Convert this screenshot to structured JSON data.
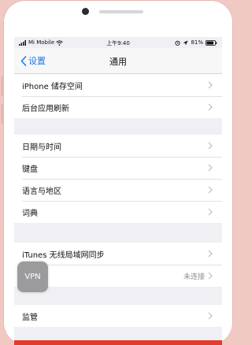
{
  "status": {
    "carrier": "Mi Mobile",
    "time": "上午9:40",
    "battery": "81%"
  },
  "nav": {
    "back_label": "设置",
    "title": "通用"
  },
  "group1": [
    {
      "label": "iPhone 储存空间"
    },
    {
      "label": "后台应用刷新"
    }
  ],
  "group2": [
    {
      "label": "日期与时间"
    },
    {
      "label": "键盘"
    },
    {
      "label": "语言与地区"
    },
    {
      "label": "词典"
    }
  ],
  "group3": [
    {
      "label": "iTunes 无线局域网同步"
    },
    {
      "label": "",
      "value": "未连接"
    }
  ],
  "vpn_badge": "VPN",
  "group4": [
    {
      "label": "监管"
    }
  ],
  "colors": {
    "accent": "#1f7aea",
    "bottom_bar": "#e53a2e"
  }
}
